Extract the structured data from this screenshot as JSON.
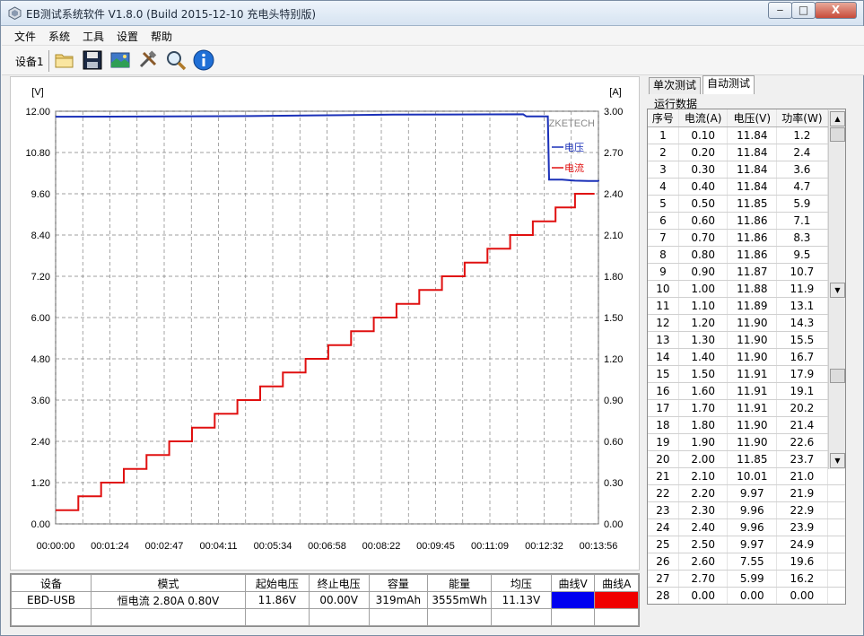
{
  "window": {
    "title": "EB测试系统软件 V1.8.0 (Build 2015-12-10 充电头特别版)",
    "minimize": "‒",
    "maximize": "□",
    "close": "X"
  },
  "menu": [
    "文件",
    "系统",
    "工具",
    "设置",
    "帮助"
  ],
  "toolbar": {
    "device_label": "设备1",
    "icons": [
      "open-folder-icon",
      "save-icon",
      "image-icon",
      "tools-icon",
      "zoom-icon",
      "info-icon"
    ]
  },
  "colors": {
    "voltage": "#1a30b8",
    "current": "#e01010",
    "grid": "#808080"
  },
  "chart_data": {
    "type": "line",
    "left_unit": "[V]",
    "right_unit": "[A]",
    "watermark_brand": "ZKETECH",
    "legend": [
      "电压",
      "电流"
    ],
    "y_left_ticks": [
      "12.00",
      "10.80",
      "9.60",
      "8.40",
      "7.20",
      "6.00",
      "4.80",
      "3.60",
      "2.40",
      "1.20",
      "0.00"
    ],
    "y_right_ticks": [
      "3.00",
      "2.70",
      "2.40",
      "2.10",
      "1.80",
      "1.50",
      "1.20",
      "0.90",
      "0.60",
      "0.30",
      "0.00"
    ],
    "x_ticks": [
      "00:00:00",
      "00:01:24",
      "00:02:47",
      "00:04:11",
      "00:05:34",
      "00:06:58",
      "00:08:22",
      "00:09:45",
      "00:11:09",
      "00:12:32",
      "00:13:56"
    ],
    "ylim_left": [
      0,
      12
    ],
    "ylim_right": [
      0,
      3
    ],
    "x_range_s": [
      0,
      836
    ],
    "series": [
      {
        "name": "电压",
        "axis": "left",
        "points": [
          [
            0,
            11.84
          ],
          [
            180,
            11.85
          ],
          [
            300,
            11.86
          ],
          [
            400,
            11.88
          ],
          [
            520,
            11.9
          ],
          [
            720,
            11.91
          ],
          [
            725,
            11.85
          ],
          [
            758,
            11.85
          ],
          [
            760,
            10.01
          ],
          [
            780,
            10.01
          ],
          [
            800,
            9.98
          ],
          [
            820,
            9.97
          ],
          [
            845,
            9.97
          ],
          [
            850,
            9.96
          ],
          [
            865,
            9.96
          ],
          [
            870,
            9.96
          ],
          [
            873,
            9.96
          ],
          [
            875,
            9.97
          ],
          [
            878,
            9.97
          ],
          [
            880,
            9.97
          ]
        ]
      },
      {
        "name": "电流",
        "axis": "right",
        "points": [
          [
            0,
            0.1
          ],
          [
            35,
            0.1
          ],
          [
            35,
            0.2
          ],
          [
            70,
            0.2
          ],
          [
            70,
            0.3
          ],
          [
            105,
            0.3
          ],
          [
            105,
            0.4
          ],
          [
            140,
            0.4
          ],
          [
            140,
            0.5
          ],
          [
            175,
            0.5
          ],
          [
            175,
            0.6
          ],
          [
            210,
            0.6
          ],
          [
            210,
            0.7
          ],
          [
            245,
            0.7
          ],
          [
            245,
            0.8
          ],
          [
            280,
            0.8
          ],
          [
            280,
            0.9
          ],
          [
            315,
            0.9
          ],
          [
            315,
            1.0
          ],
          [
            350,
            1.0
          ],
          [
            350,
            1.1
          ],
          [
            385,
            1.1
          ],
          [
            385,
            1.2
          ],
          [
            420,
            1.2
          ],
          [
            420,
            1.3
          ],
          [
            455,
            1.3
          ],
          [
            455,
            1.4
          ],
          [
            490,
            1.4
          ],
          [
            490,
            1.5
          ],
          [
            525,
            1.5
          ],
          [
            525,
            1.6
          ],
          [
            560,
            1.6
          ],
          [
            560,
            1.7
          ],
          [
            595,
            1.7
          ],
          [
            595,
            1.8
          ],
          [
            630,
            1.8
          ],
          [
            630,
            1.9
          ],
          [
            665,
            1.9
          ],
          [
            665,
            2.0
          ],
          [
            700,
            2.0
          ],
          [
            700,
            2.1
          ],
          [
            735,
            2.1
          ],
          [
            735,
            2.2
          ],
          [
            770,
            2.2
          ],
          [
            770,
            2.3
          ],
          [
            800,
            2.3
          ],
          [
            800,
            2.4
          ],
          [
            830,
            2.4
          ]
        ]
      }
    ]
  },
  "summary": {
    "headers": [
      "设备",
      "模式",
      "起始电压",
      "终止电压",
      "容量",
      "能量",
      "均压",
      "曲线V",
      "曲线A"
    ],
    "values": [
      "EBD-USB",
      "恒电流  2.80A  0.80V",
      "11.86V",
      "00.00V",
      "319mAh",
      "3555mWh",
      "11.13V",
      "",
      ""
    ]
  },
  "tabs": [
    "单次测试",
    "自动测试"
  ],
  "run_data_label": "运行数据",
  "run_table": {
    "headers": [
      "序号",
      "电流(A)",
      "电压(V)",
      "功率(W)"
    ],
    "rows": [
      [
        "1",
        "0.10",
        "11.84",
        "1.2"
      ],
      [
        "2",
        "0.20",
        "11.84",
        "2.4"
      ],
      [
        "3",
        "0.30",
        "11.84",
        "3.6"
      ],
      [
        "4",
        "0.40",
        "11.84",
        "4.7"
      ],
      [
        "5",
        "0.50",
        "11.85",
        "5.9"
      ],
      [
        "6",
        "0.60",
        "11.86",
        "7.1"
      ],
      [
        "7",
        "0.70",
        "11.86",
        "8.3"
      ],
      [
        "8",
        "0.80",
        "11.86",
        "9.5"
      ],
      [
        "9",
        "0.90",
        "11.87",
        "10.7"
      ],
      [
        "10",
        "1.00",
        "11.88",
        "11.9"
      ],
      [
        "11",
        "1.10",
        "11.89",
        "13.1"
      ],
      [
        "12",
        "1.20",
        "11.90",
        "14.3"
      ],
      [
        "13",
        "1.30",
        "11.90",
        "15.5"
      ],
      [
        "14",
        "1.40",
        "11.90",
        "16.7"
      ],
      [
        "15",
        "1.50",
        "11.91",
        "17.9"
      ],
      [
        "16",
        "1.60",
        "11.91",
        "19.1"
      ],
      [
        "17",
        "1.70",
        "11.91",
        "20.2"
      ],
      [
        "18",
        "1.80",
        "11.90",
        "21.4"
      ],
      [
        "19",
        "1.90",
        "11.90",
        "22.6"
      ],
      [
        "20",
        "2.00",
        "11.85",
        "23.7"
      ],
      [
        "21",
        "2.10",
        "10.01",
        "21.0"
      ],
      [
        "22",
        "2.20",
        "9.97",
        "21.9"
      ],
      [
        "23",
        "2.30",
        "9.96",
        "22.9"
      ],
      [
        "24",
        "2.40",
        "9.96",
        "23.9"
      ],
      [
        "25",
        "2.50",
        "9.97",
        "24.9"
      ],
      [
        "26",
        "2.60",
        "7.55",
        "19.6"
      ],
      [
        "27",
        "2.70",
        "5.99",
        "16.2"
      ],
      [
        "28",
        "0.00",
        "0.00",
        "0.00"
      ]
    ]
  }
}
